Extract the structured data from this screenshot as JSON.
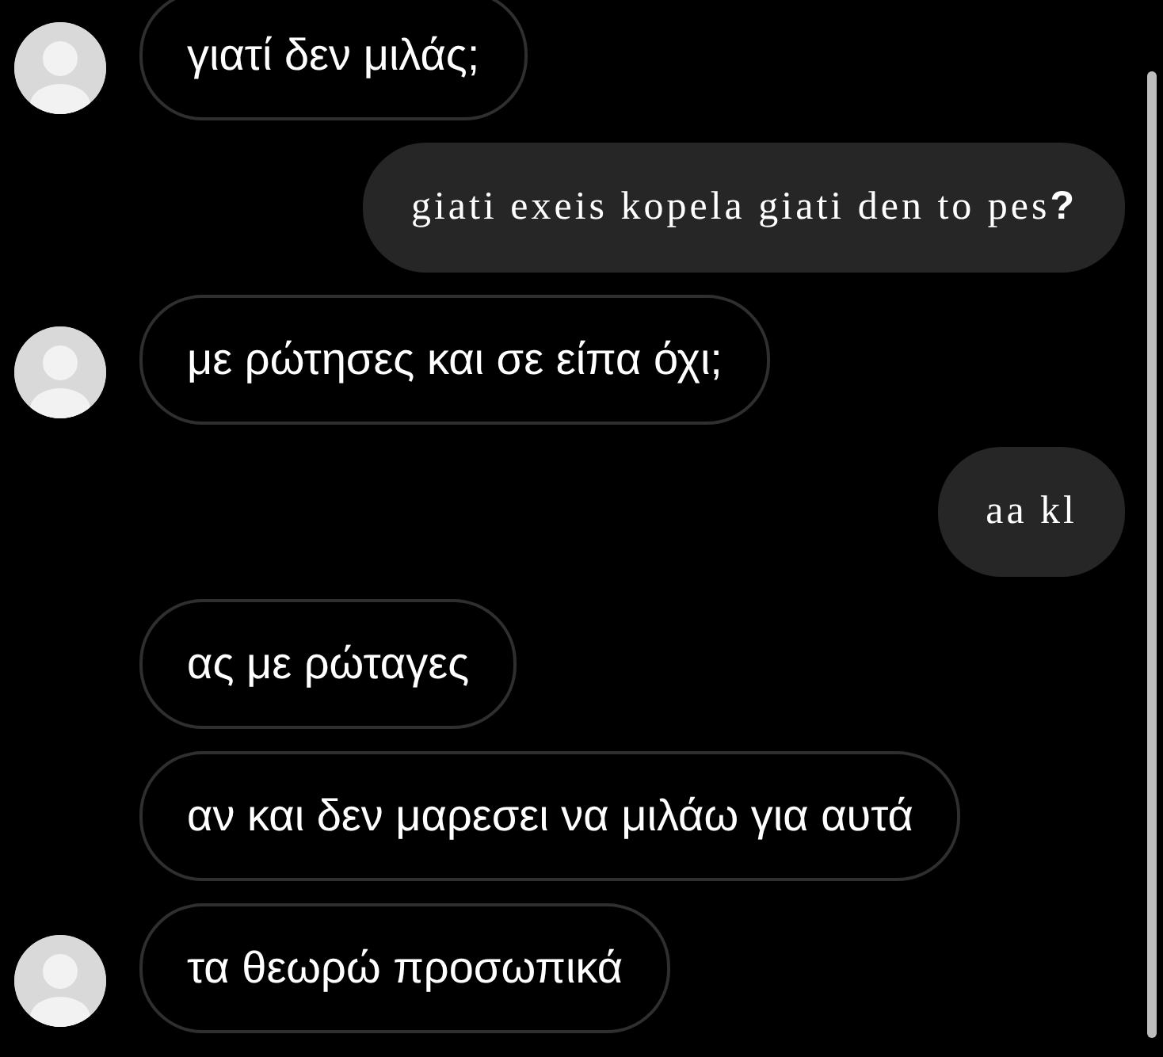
{
  "messages": [
    {
      "kind": "incoming",
      "text": "γιατί δεν μιλάς;",
      "avatar": true
    },
    {
      "kind": "outgoing",
      "text": "giati exeis kopela giati den to pes**?**"
    },
    {
      "kind": "incoming",
      "text": "με ρώτησες και σε είπα όχι;",
      "avatar": true
    },
    {
      "kind": "outgoing",
      "text": "aa kl"
    },
    {
      "kind": "incoming",
      "text": "ας με ρώταγες",
      "avatar": false
    },
    {
      "kind": "incoming",
      "text": "αν και δεν μαρεσει να μιλάω για αυτά",
      "avatar": false
    },
    {
      "kind": "incoming",
      "text": "τα θεωρώ προσωπικά",
      "avatar": true
    }
  ]
}
